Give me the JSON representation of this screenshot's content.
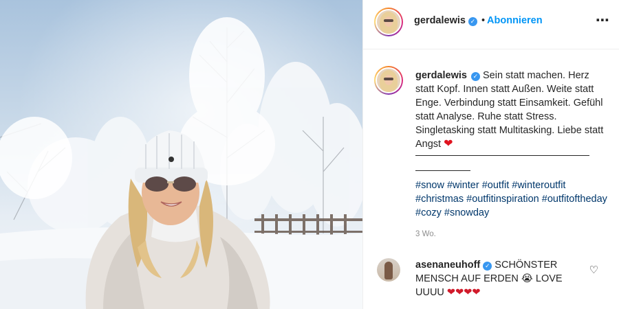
{
  "post": {
    "author": {
      "username": "gerdalewis",
      "verified_badge": "✓",
      "follow_label": "Abonnieren",
      "separator": "•"
    },
    "more_icon": "⋯",
    "caption": {
      "username": "gerdalewis",
      "verified_badge": "✓",
      "text": "Sein statt machen. Herz statt Kopf. Innen statt Außen. Weite statt Enge. Verbindung statt Einsamkeit. Gefühl statt Analyse. Ruhe statt Stress. Singletasking statt Multitasking. Liebe statt Angst",
      "emoji": "❤"
    },
    "hashtags": [
      "#snow",
      "#winter",
      "#outfit",
      "#winteroutfit",
      "#christmas",
      "#outfitinspiration",
      "#outfitoftheday",
      "#cozy",
      "#snowday"
    ],
    "timestamp": "3 Wo."
  },
  "comment": {
    "username": "asenaneuhoff",
    "verified_badge": "✓",
    "text_part1": "SCHÖNSTER MENSCH AUF ERDEN",
    "emoji1": "😭",
    "text_part2": "LOVE UUUU",
    "hearts": "❤❤❤❤",
    "like_icon": "♡"
  },
  "colors": {
    "link_blue": "#0095f6",
    "hashtag": "#00376b",
    "verified": "#3897f0",
    "muted": "#8e8e8e"
  }
}
